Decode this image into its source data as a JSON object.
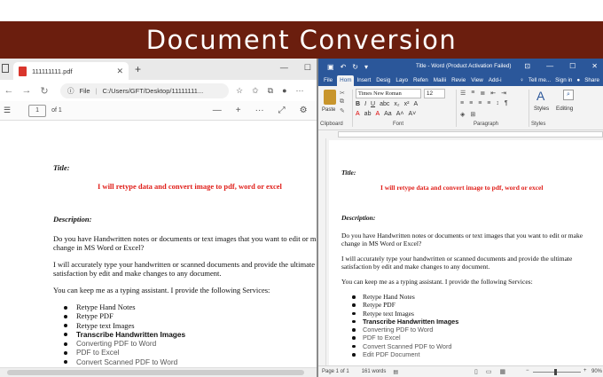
{
  "banner": {
    "title": "Document Conversion"
  },
  "edge": {
    "tab_title": "111111111.pdf",
    "tab_close": "✕",
    "new_tab": "+",
    "window_controls": [
      "—",
      "☐",
      "✕"
    ],
    "nav": {
      "back": "←",
      "forward": "→",
      "refresh": "↻"
    },
    "address": {
      "file_label": "File",
      "path": "C:/Users/GFT/Desktop/11111111..."
    },
    "pdf_toolbar": {
      "page_number": "1",
      "page_of": "of 1",
      "zoom_out": "—",
      "zoom_in": "+",
      "more": "···"
    }
  },
  "document": {
    "title_label": "Title:",
    "title": "I will retype data and convert image to pdf, word or excel",
    "description_label": "Description:",
    "para1": "Do you have Handwritten notes or documents or text images that you want to edit or make change in MS Word or Excel?",
    "para2": "I will accurately type your handwritten or scanned documents and provide the ultimate satisfaction by edit and make changes to any document.",
    "para3": "You can keep me as a typing assistant. I provide the following Services:",
    "services": [
      "Retype Hand Notes",
      "Retype PDF",
      "Retype text Images",
      "Transcribe Handwritten Images",
      "Converting PDF to Word",
      "PDF to Excel",
      "Convert Scanned PDF to Word",
      "Edit PDF Document"
    ]
  },
  "edge_doc_display": {
    "para1": "Do you have Handwritten notes or documents or text images that you want to edit or make change in MS Word or Excel?",
    "para2": "I will accurately type your handwritten or scanned documents and provide the ultimate satisfaction by edit and make changes to any document."
  },
  "word": {
    "window_title": "Title - Word (Product Activation Failed)",
    "window_controls": [
      "—",
      "☐",
      "✕"
    ],
    "tabs": [
      "File",
      "Hom",
      "Insert",
      "Desig",
      "Layo",
      "Refen",
      "Mailii",
      "Revie",
      "View",
      "Add-i"
    ],
    "tell_me": "Tell me...",
    "sign_in": "Sign in",
    "share": "Share",
    "ribbon": {
      "paste": "Paste",
      "font_name": "Times New Roman",
      "font_size": "12",
      "styles": "Styles",
      "editing": "Editing",
      "groups": [
        "Clipboard",
        "Font",
        "Paragraph",
        "Styles"
      ]
    },
    "status": {
      "page": "Page 1 of 1",
      "words": "161 words",
      "zoom": "90%"
    }
  },
  "colors": {
    "banner_bg": "#6b1e0e",
    "word_blue": "#2b579a",
    "title_red": "#e0201b"
  }
}
